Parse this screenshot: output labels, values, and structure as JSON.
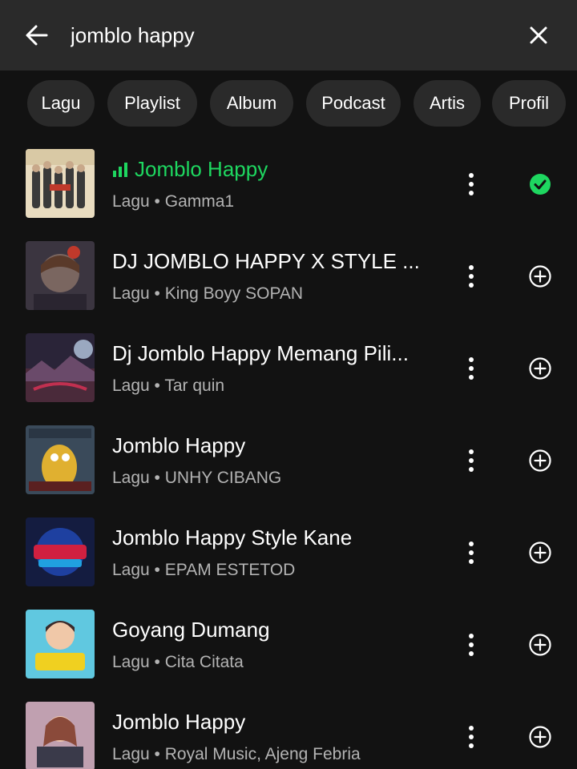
{
  "search": {
    "query": "jomblo happy",
    "back_icon": "arrow-left-icon",
    "clear_icon": "close-icon"
  },
  "chips": [
    "Lagu",
    "Playlist",
    "Album",
    "Podcast",
    "Artis",
    "Profil"
  ],
  "colors": {
    "accent": "#1ed760",
    "background": "#121212",
    "header": "#2a2a2a",
    "chip": "#2a2a2a",
    "subtext": "#b3b3b3"
  },
  "results": [
    {
      "title": "Jomblo Happy",
      "subtitle": "Lagu • Gamma1",
      "playing": true,
      "added": true
    },
    {
      "title": "DJ JOMBLO HAPPY X STYLE ...",
      "subtitle": "Lagu • King Boyy SOPAN",
      "playing": false,
      "added": false
    },
    {
      "title": "Dj Jomblo Happy Memang Pili...",
      "subtitle": "Lagu • Tar quin",
      "playing": false,
      "added": false
    },
    {
      "title": "Jomblo Happy",
      "subtitle": "Lagu • UNHY CIBANG",
      "playing": false,
      "added": false
    },
    {
      "title": "Jomblo Happy Style Kane",
      "subtitle": "Lagu • EPAM ESTETOD",
      "playing": false,
      "added": false
    },
    {
      "title": "Goyang Dumang",
      "subtitle": "Lagu • Cita Citata",
      "playing": false,
      "added": false
    },
    {
      "title": "Jomblo Happy",
      "subtitle": "Lagu • Royal Music, Ajeng Febria",
      "playing": false,
      "added": false
    }
  ]
}
